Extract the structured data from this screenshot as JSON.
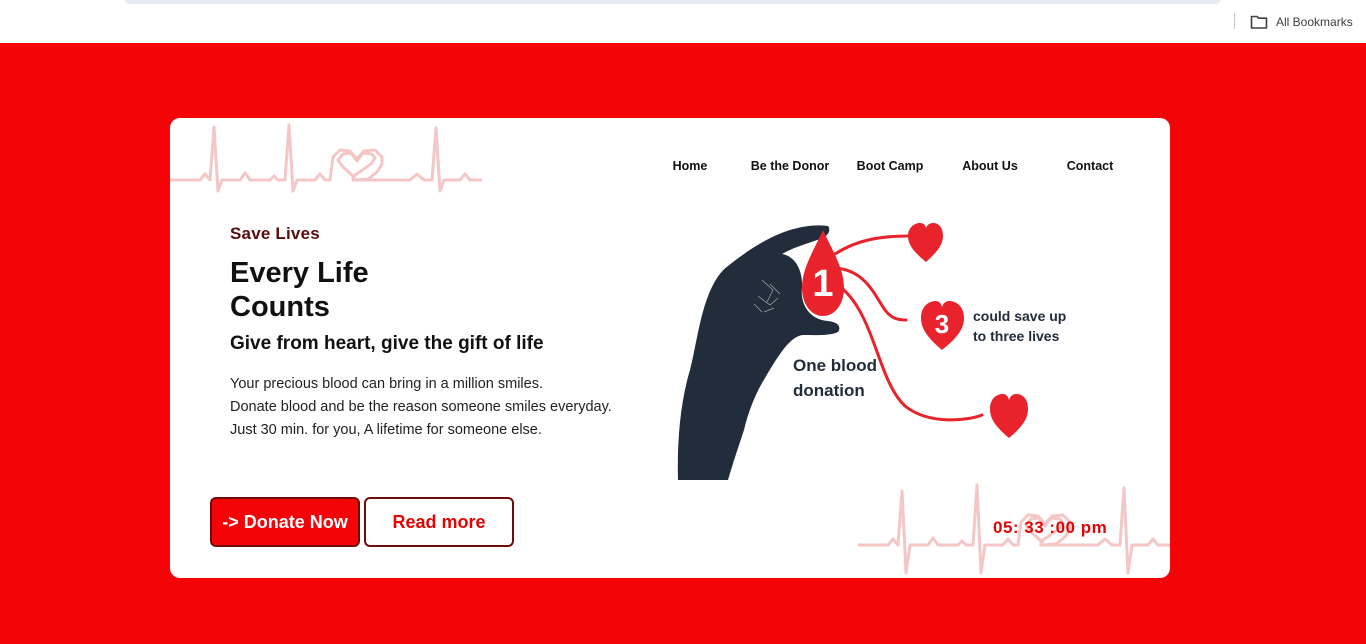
{
  "browser": {
    "bookmarks_label": "All Bookmarks",
    "folder_icon": "folder-icon"
  },
  "nav": {
    "items": [
      {
        "label": "Home"
      },
      {
        "label": "Be the Donor"
      },
      {
        "label": "Boot Camp"
      },
      {
        "label": "About Us"
      },
      {
        "label": "Contact"
      }
    ]
  },
  "hero": {
    "eyebrow": "Save Lives",
    "headline_line1": "Every Life",
    "headline_line2": "Counts",
    "subhead": "Give from heart, give the gift of life",
    "description": [
      "Your precious blood can bring in a million smiles.",
      "Donate blood and be the reason someone smiles everyday.",
      "Just 30 min. for you, A lifetime for someone else."
    ],
    "donate_button": "-> Donate Now",
    "read_more_button": "Read more"
  },
  "illustration": {
    "drop_number": "1",
    "heart_number": "3",
    "caption_line1": "One blood",
    "caption_line2": "donation",
    "callout_line1": "could save up",
    "callout_line2": "to three lives"
  },
  "clock": {
    "time": "05: 33 :00 pm"
  },
  "colors": {
    "page_background": "#f30406",
    "accent_red": "#e10606",
    "dark_red_text": "#5a0d0d",
    "ecg_pink": "#f4c6c6",
    "hand_navy": "#212d3b",
    "heart_red": "#e8232b"
  }
}
